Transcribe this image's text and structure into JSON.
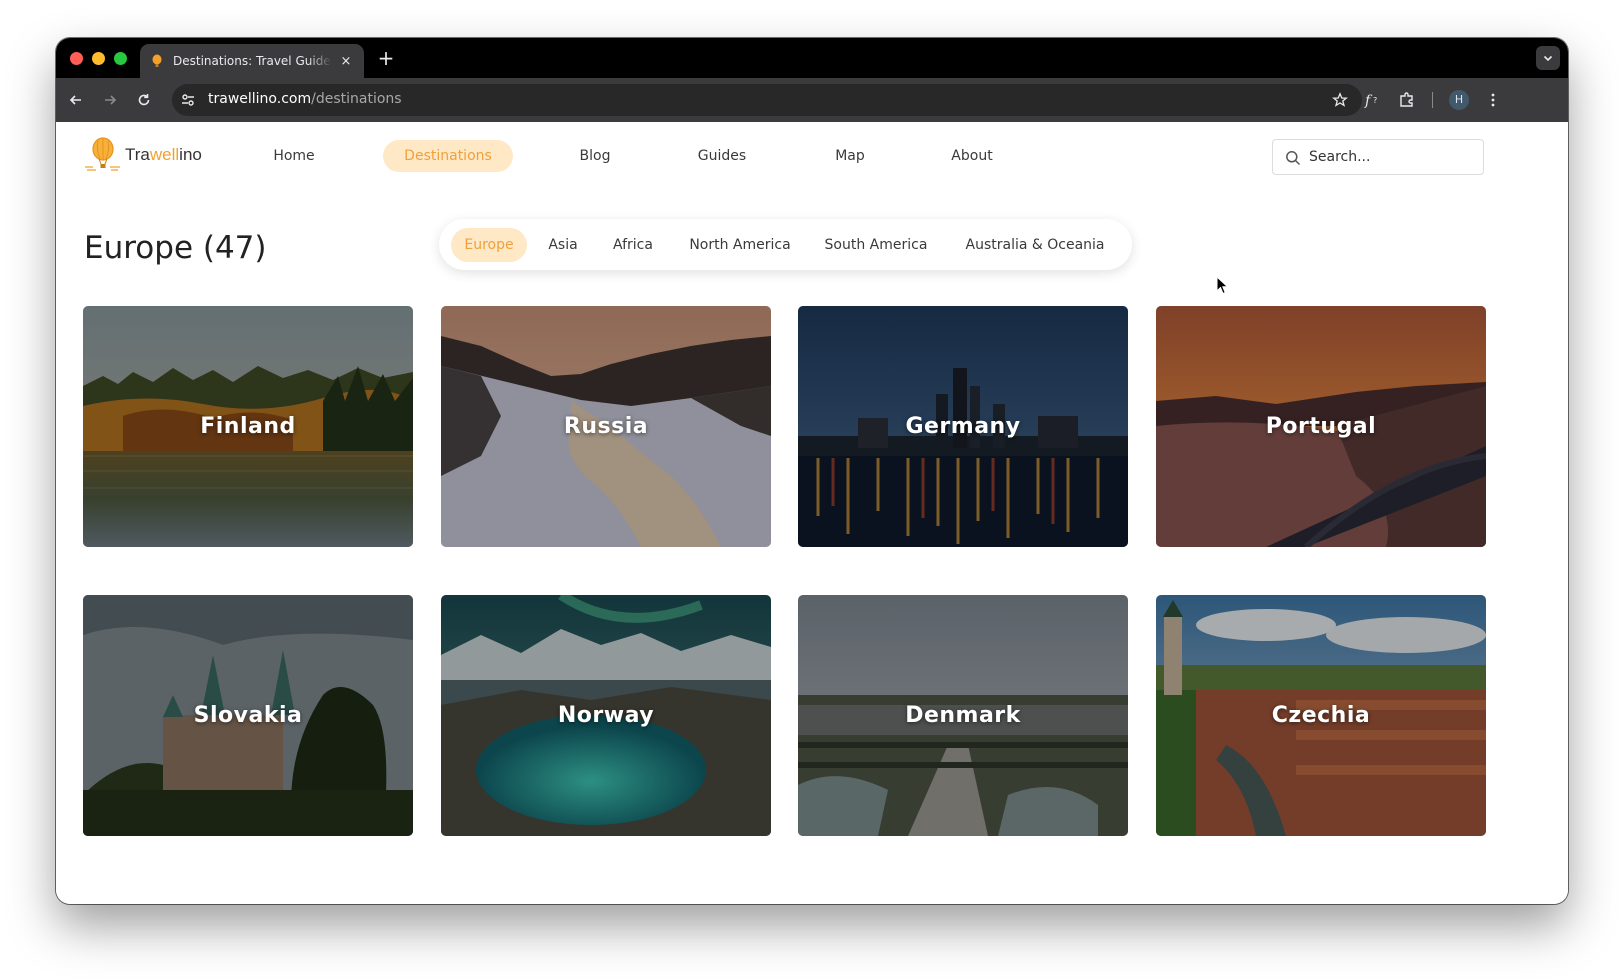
{
  "browser": {
    "tab_title": "Destinations: Travel Guides for",
    "new_tab": "+",
    "close_tab": "×",
    "url_host": "trawellino.com",
    "url_path": "/destinations",
    "profile_initial": "H"
  },
  "site": {
    "logo_prefix": "Tra",
    "logo_accent": "well",
    "logo_suffix": "ino",
    "nav": {
      "home": "Home",
      "destinations": "Destinations",
      "blog": "Blog",
      "guides": "Guides",
      "map": "Map",
      "about": "About"
    },
    "search_placeholder": "Search..."
  },
  "main": {
    "heading": "Europe (47)",
    "regions": {
      "europe": "Europe",
      "asia": "Asia",
      "africa": "Africa",
      "north_america": "North America",
      "south_america": "South America",
      "oceania": "Australia & Oceania"
    },
    "destinations": {
      "finland": "Finland",
      "russia": "Russia",
      "germany": "Germany",
      "portugal": "Portugal",
      "slovakia": "Slovakia",
      "norway": "Norway",
      "denmark": "Denmark",
      "czechia": "Czechia"
    }
  },
  "colors": {
    "accent": "#f4a12b",
    "accent_bg": "#ffe8c6",
    "chrome_dark": "#000000",
    "chrome_toolbar": "#3b3b3e"
  }
}
